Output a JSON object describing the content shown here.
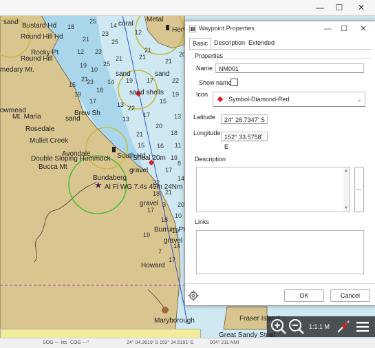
{
  "chart": {
    "labels": {
      "bustard": "Bustard Hd",
      "roundhill_hd": "Round Hill Hd",
      "rocky_pt": "Rocky Pt",
      "round_hill": "Round Hill",
      "medary": "medary Mt.",
      "mt_maria": "Mt. Maria",
      "owmead": "owmead",
      "rosedale": "Rosedale",
      "mullet": "Mullet Creek",
      "avondale": "Avondale",
      "double_sloping": "Double Sloping Hummock",
      "bucca": "Bucca Mt",
      "bundaberg": "Bundaberg",
      "south_hd": "South Hd",
      "light": "Al Fl WG 7.4s 49m 24Nm",
      "howard": "Howard",
      "maryborough": "Maryborough",
      "metal": "Metal",
      "herv": "Herv",
      "fraser": "Fraser Island",
      "great_sandy": "Great Sandy Strait",
      "burrum": "Burrum Pt",
      "gravel1": "gravel",
      "gravel2": "gravel",
      "gravel3": "gravel",
      "sand_shells": "sand shells",
      "sand1": "sand",
      "sand2": "sand",
      "sand3": "sand",
      "sand4": "sand",
      "coral": "coral",
      "shoal_20m": "Shoal 20m",
      "brew": "Brew Sh"
    },
    "depths": [
      "25",
      "23",
      "25",
      "23",
      "21",
      "21",
      "25",
      "21",
      "19",
      "21",
      "23",
      "19",
      "17",
      "18",
      "21",
      "19",
      "22",
      "17",
      "13",
      "15",
      "19",
      "17",
      "13",
      "13",
      "20",
      "18",
      "21",
      "16",
      "11",
      "15",
      "19",
      "17",
      "22",
      "14",
      "21",
      "18",
      "20",
      "17",
      "18",
      "10",
      "12",
      "20",
      "18",
      "12",
      "10",
      "14",
      "22",
      "21",
      "15",
      "14",
      "8",
      "19",
      "19",
      "3",
      "14",
      "7",
      "17"
    ],
    "scale": "1:1.1 M",
    "status_sog": "SOG --- kts",
    "status_cog": "COG ---°",
    "status_pos": "24° 04.3619' S  153° 34.5191' E",
    "status_brg": "004° 211 NMI"
  },
  "window": {
    "minimize": "—",
    "maximize": "☐",
    "close": "✕"
  },
  "dialog": {
    "title": "Waypoint Properties",
    "tabs": [
      "Basic",
      "Description",
      "Extended"
    ],
    "section_properties": "Properties",
    "name_label": "Name",
    "name_value": "NM001",
    "show_name_label": "Show name",
    "icon_label": "Icon",
    "icon_value": "Symbol-Diamond-Red",
    "latitude_label": "Latitude",
    "latitude_value": "24° 26.7347' S",
    "longitude_label": "Longitude",
    "longitude_value": "152° 33.5758' E",
    "description_label": "Description",
    "links_label": "Links",
    "ellipsis": "...",
    "ok": "OK",
    "cancel": "Cancel"
  }
}
